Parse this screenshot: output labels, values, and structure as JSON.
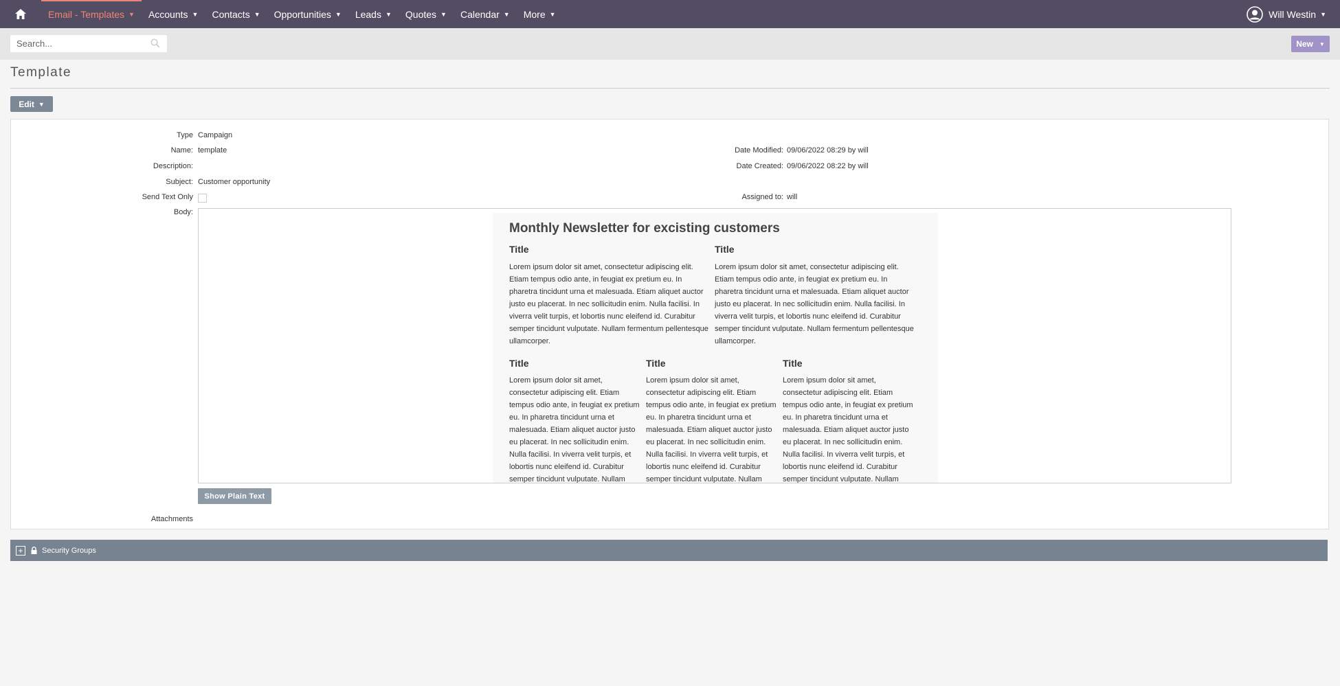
{
  "nav": {
    "items": [
      {
        "label": "Email - Templates",
        "active": true
      },
      {
        "label": "Accounts"
      },
      {
        "label": "Contacts"
      },
      {
        "label": "Opportunities"
      },
      {
        "label": "Leads"
      },
      {
        "label": "Quotes"
      },
      {
        "label": "Calendar"
      },
      {
        "label": "More"
      }
    ],
    "user": "Will Westin"
  },
  "search": {
    "placeholder": "Search..."
  },
  "actions": {
    "new_label": "New",
    "edit_label": "Edit",
    "show_plain_text": "Show Plain Text"
  },
  "page": {
    "title": "Template"
  },
  "detail": {
    "type_label": "Type",
    "type_value": "Campaign",
    "name_label": "Name:",
    "name_value": "template",
    "description_label": "Description:",
    "subject_label": "Subject:",
    "subject_value": "Customer opportunity",
    "send_text_label": "Send Text Only",
    "body_label": "Body:",
    "attachments_label": "Attachments",
    "date_modified_label": "Date Modified:",
    "date_modified_value": "09/06/2022 08:29 by will",
    "date_created_label": "Date Created:",
    "date_created_value": "09/06/2022 08:22 by will",
    "assigned_label": "Assigned to:",
    "assigned_value": "will"
  },
  "newsletter": {
    "heading": "Monthly Newsletter for excisting customers",
    "col_title": "Title",
    "lorem": "Lorem ipsum dolor sit amet, consectetur adipiscing elit. Etiam tempus odio ante, in feugiat ex pretium eu. In pharetra tincidunt urna et malesuada. Etiam aliquet auctor justo eu placerat. In nec sollicitudin enim. Nulla facilisi. In viverra velit turpis, et lobortis nunc eleifend id. Curabitur semper tincidunt vulputate. Nullam fermentum pellentesque ullamcorper."
  },
  "security": {
    "label": "Security Groups"
  },
  "colors": {
    "nav_bg": "#534d64",
    "active": "#f08377",
    "new_btn": "#a193c7",
    "edit_btn": "#7d8897",
    "section_bar": "#778390"
  }
}
